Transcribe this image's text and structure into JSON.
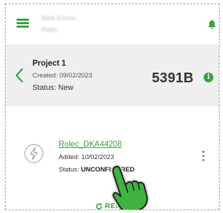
{
  "header": {
    "user_name": "Mark Emson",
    "company": "Rolec"
  },
  "project": {
    "title": "Project 1",
    "created": "Created: 09/02/2023",
    "status": "Status: New",
    "code": "5391B"
  },
  "device": {
    "name": "Rolec_DKA44208",
    "added": "Added: 10/02/2023",
    "status_label": "Status: ",
    "status_value": "UNCONFIGURED",
    "refresh_label": "REFRESH"
  },
  "colors": {
    "accent": "#34a33a",
    "project_background": "#efefef",
    "text_dark": "#333333"
  },
  "icons": [
    "menu-icon",
    "bell-icon",
    "back-chevron-icon",
    "info-icon",
    "charger-icon",
    "more-options-icon",
    "refresh-icon",
    "pointing-hand-icon"
  ]
}
